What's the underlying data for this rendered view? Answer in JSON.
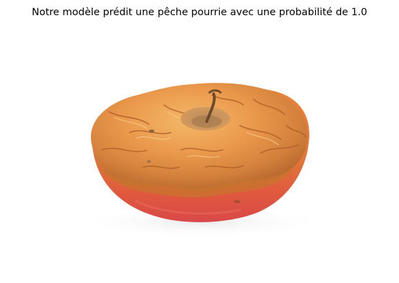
{
  "figure": {
    "title": "Notre modèle prédit une pêche pourrie avec une probabilité de 1.0"
  },
  "image": {
    "subject": "rotten-peach",
    "colors": {
      "background": "#ffffff",
      "skin_red": "#e24e45",
      "skin_orange": "#e8843a",
      "rot_light": "#f0a85a",
      "rot_dark": "#b8652a",
      "stem": "#6b4a2a"
    }
  }
}
